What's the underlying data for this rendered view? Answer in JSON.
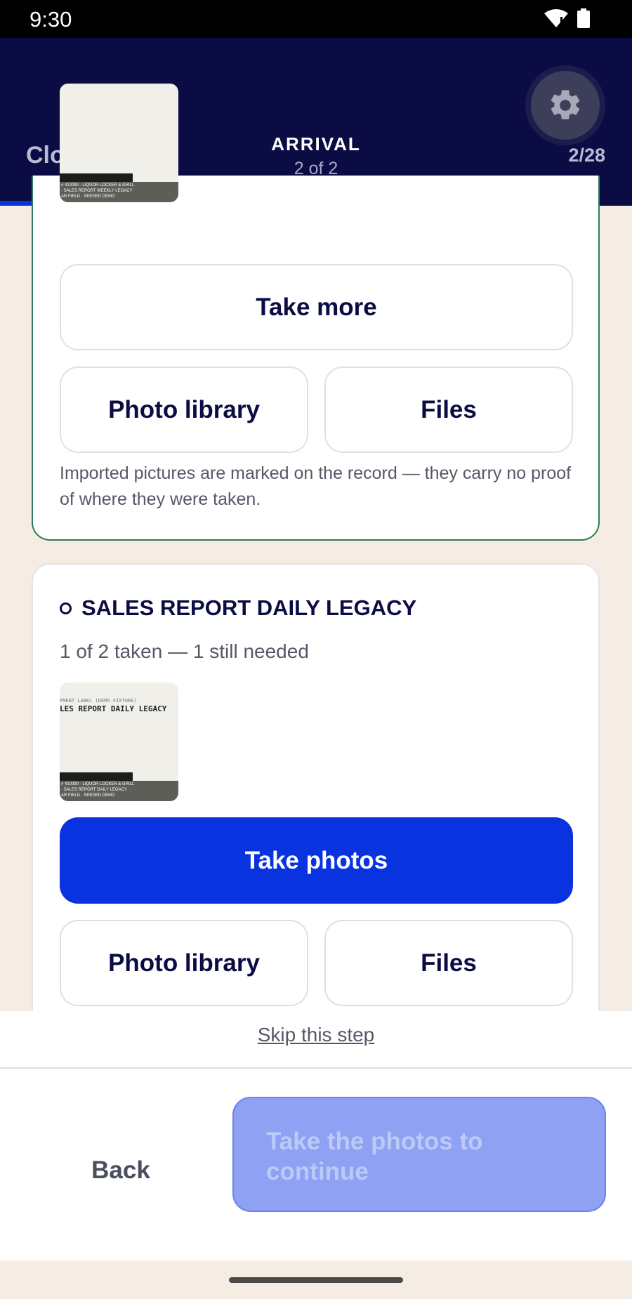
{
  "status_bar": {
    "time": "9:30"
  },
  "header": {
    "close_label": "Close",
    "title": "ARRIVAL",
    "subtitle": "2 of 2",
    "counter": "2/28",
    "settings_icon": "gear-icon",
    "progress_fraction": 0.07
  },
  "card1": {
    "thumb": {
      "footer_lines": [
        "# 410090 · LIQUOR LOCKER & GRILL",
        "· SALES REPORT WEEKLY LEGACY",
        "AR FIELD · SEEDED DEMO"
      ]
    },
    "take_more_label": "Take more",
    "photo_library_label": "Photo library",
    "files_label": "Files",
    "note": "Imported pictures are marked on the record — they carry no proof of where they were taken."
  },
  "card2": {
    "title": "SALES REPORT DAILY LEGACY",
    "status_text": "1 of 2 taken — 1 still needed",
    "thumb": {
      "top_line": "PMENT LABEL (DEMO FIXTURE)",
      "label": "LES REPORT DAILY LEGACY",
      "footer_lines": [
        "# 410090 · LIQUOR LOCKER & GRILL",
        "· SALES REPORT DAILY LEGACY",
        "AR FIELD · SEEDED DEMO"
      ]
    },
    "take_photos_label": "Take photos",
    "photo_library_label": "Photo library",
    "files_label": "Files"
  },
  "skip_label": "Skip this step",
  "footer": {
    "back_label": "Back",
    "continue_label": "Take the photos to continue"
  },
  "colors": {
    "header_bg": "#0b0c44",
    "accent": "#0a33e0",
    "card_success_border": "#2e7d5b",
    "background": "#f5ece3"
  }
}
